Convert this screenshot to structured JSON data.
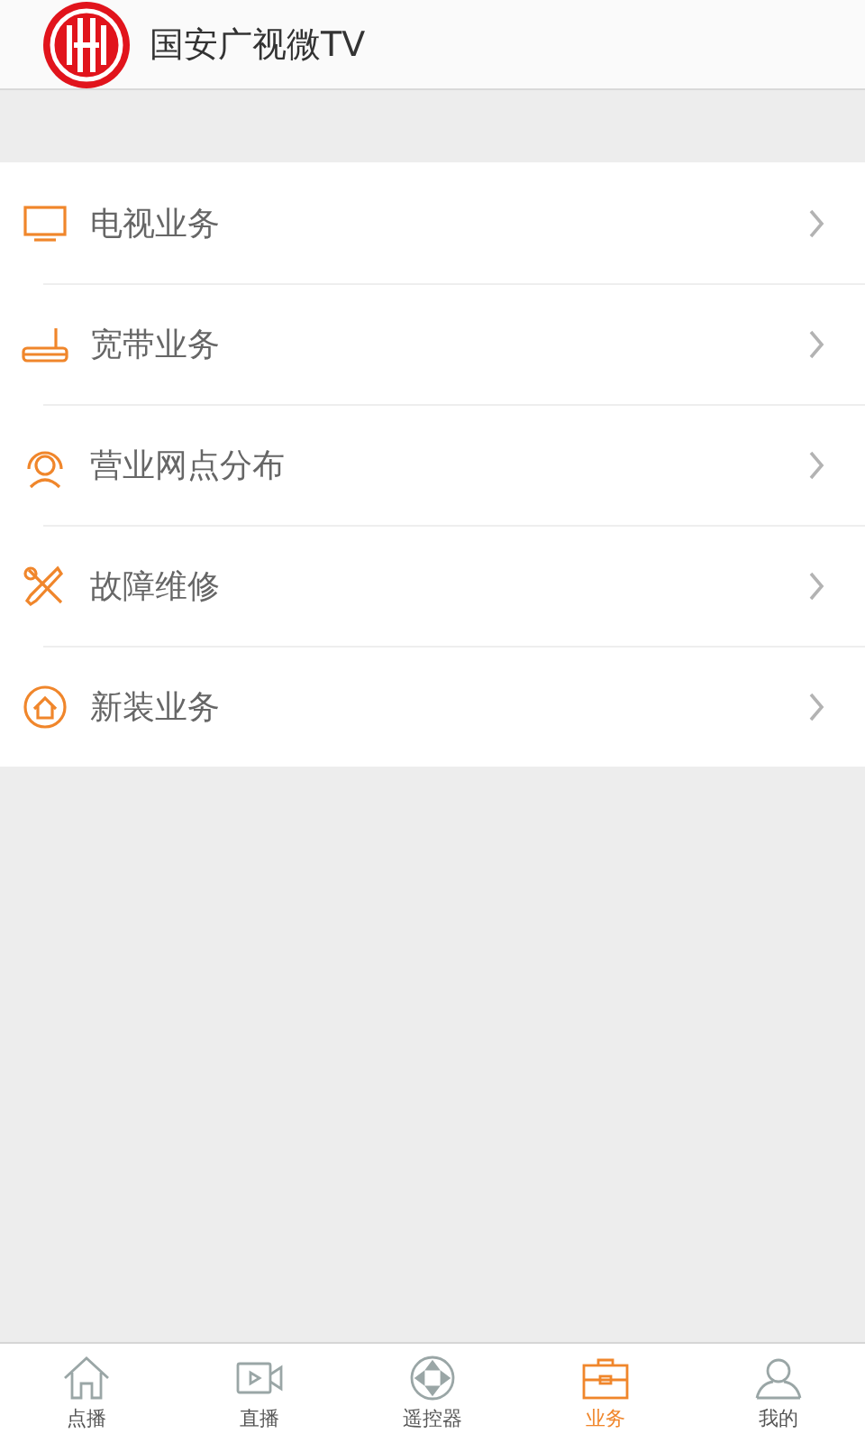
{
  "header": {
    "title": "国安广视微TV"
  },
  "items": [
    {
      "label": "电视业务",
      "kind": "tv"
    },
    {
      "label": "宽带业务",
      "kind": "router"
    },
    {
      "label": "营业网点分布",
      "kind": "service"
    },
    {
      "label": "故障维修",
      "kind": "repair"
    },
    {
      "label": "新装业务",
      "kind": "home"
    }
  ],
  "tabs": [
    {
      "label": "点播",
      "kind": "home",
      "selected": false
    },
    {
      "label": "直播",
      "kind": "video",
      "selected": false
    },
    {
      "label": "遥控器",
      "kind": "remote",
      "selected": false
    },
    {
      "label": "业务",
      "kind": "briefcase",
      "selected": true
    },
    {
      "label": "我的",
      "kind": "user",
      "selected": false
    }
  ]
}
